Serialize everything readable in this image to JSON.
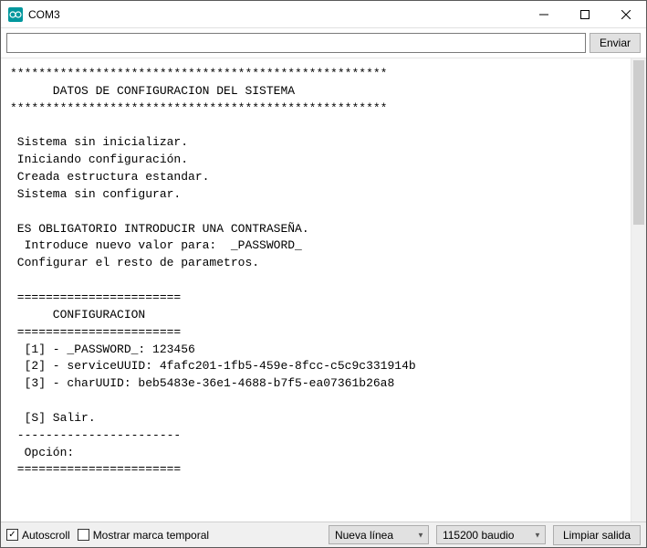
{
  "window": {
    "title": "COM3"
  },
  "input": {
    "value": "",
    "placeholder": ""
  },
  "buttons": {
    "send": "Enviar",
    "clear": "Limpiar salida"
  },
  "console_text": "*****************************************************\n      DATOS DE CONFIGURACION DEL SISTEMA\n*****************************************************\n\n Sistema sin inicializar.\n Iniciando configuración.\n Creada estructura estandar.\n Sistema sin configurar.\n\n ES OBLIGATORIO INTRODUCIR UNA CONTRASEÑA.\n  Introduce nuevo valor para:  _PASSWORD_\n Configurar el resto de parametros.\n\n =======================\n      CONFIGURACION\n =======================\n  [1] - _PASSWORD_: 123456\n  [2] - serviceUUID: 4fafc201-1fb5-459e-8fcc-c5c9c331914b\n  [3] - charUUID: beb5483e-36e1-4688-b7f5-ea07361b26a8\n\n  [S] Salir.\n -----------------------\n  Opción:\n =======================",
  "footer": {
    "autoscroll_label": "Autoscroll",
    "autoscroll_checked": true,
    "timestamp_label": "Mostrar marca temporal",
    "timestamp_checked": false,
    "line_ending": "Nueva línea",
    "baud": "115200 baudio"
  }
}
